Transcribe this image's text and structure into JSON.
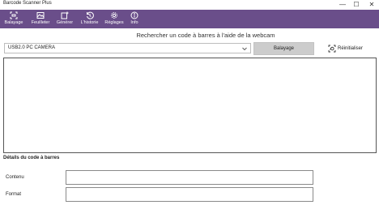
{
  "window": {
    "title": "Barcode Scanner Plus",
    "controls": {
      "minimize": "—",
      "maximize": "☐",
      "close": "✕"
    }
  },
  "toolbar": {
    "items": [
      {
        "label": "Balayage",
        "icon": "scan-icon"
      },
      {
        "label": "Feuilleter",
        "icon": "browse-image-icon"
      },
      {
        "label": "Générer",
        "icon": "generate-icon"
      },
      {
        "label": "L'historie",
        "icon": "history-icon"
      },
      {
        "label": "Réglages",
        "icon": "gear-icon"
      },
      {
        "label": "Info",
        "icon": "info-icon"
      }
    ]
  },
  "main": {
    "heading": "Rechercher un code à barres à l'aide de la webcam",
    "camera_select": {
      "value": "USB2.0 PC CAMERA"
    },
    "scan_button": "Balayage",
    "reset_button": "Réinitialiser",
    "details_title": "Détails du code à barres",
    "fields": [
      {
        "label": "Contenu",
        "value": ""
      },
      {
        "label": "Format",
        "value": ""
      }
    ]
  },
  "colors": {
    "toolbar_bg": "#6a4e8a",
    "button_bg": "#cccccc"
  }
}
